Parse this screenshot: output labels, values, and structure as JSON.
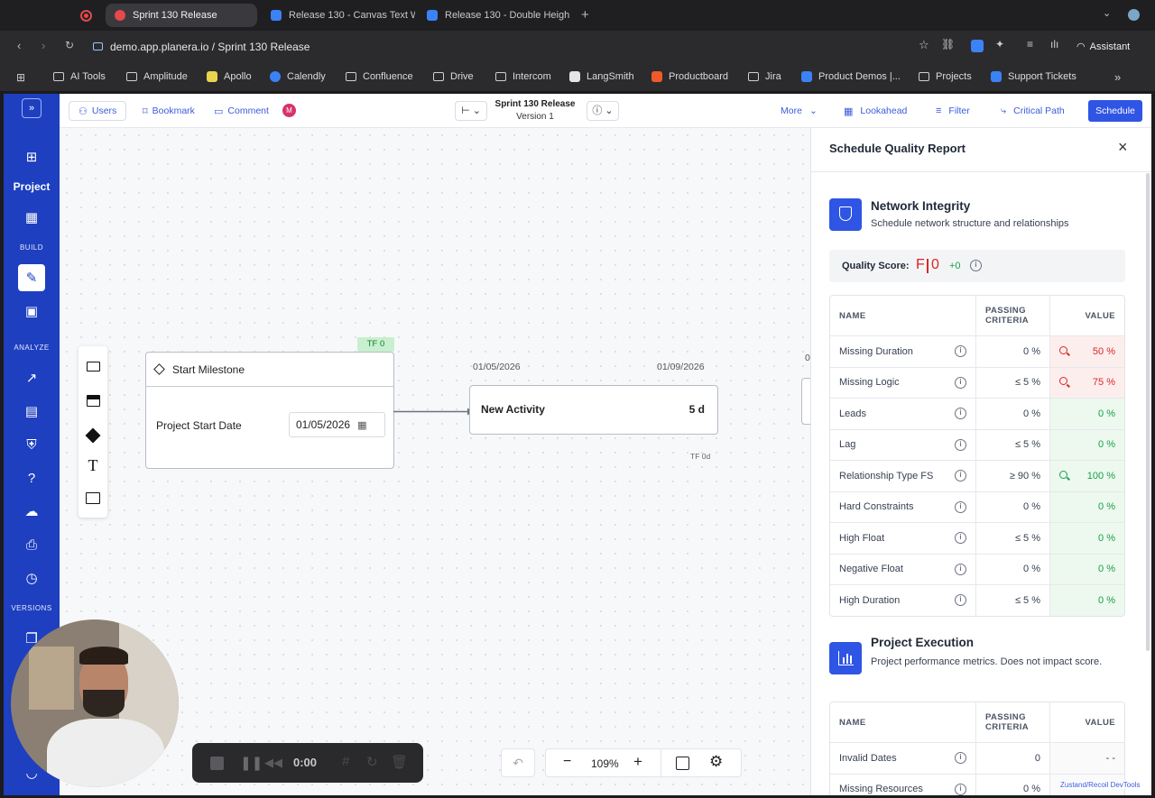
{
  "browser": {
    "tabs": [
      {
        "title": "Sprint 130 Release",
        "active": true
      },
      {
        "title": "Release 130 - Canvas Text W",
        "active": false
      },
      {
        "title": "Release 130 - Double Heigh",
        "active": false
      }
    ],
    "url": "demo.app.planera.io / Sprint 130 Release",
    "assistant_label": "Assistant",
    "bookmarks": [
      "AI Tools",
      "Amplitude",
      "Apollo",
      "Calendly",
      "Confluence",
      "Drive",
      "Intercom",
      "LangSmith",
      "Productboard",
      "Jira",
      "Product Demos |...",
      "Projects",
      "Support Tickets"
    ]
  },
  "sidenav": {
    "project_label": "Project",
    "section_build": "BUILD",
    "section_analyze": "ANALYZE",
    "section_versions": "VERSIONS"
  },
  "toolbar": {
    "users": "Users",
    "bookmark": "Bookmark",
    "comment": "Comment",
    "avatar": "M",
    "title": "Sprint 130 Release",
    "version": "Version 1",
    "more": "More",
    "lookahead": "Lookahead",
    "filter": "Filter",
    "critical_path": "Critical Path",
    "schedule": "Schedule"
  },
  "canvas": {
    "milestone": {
      "tf_badge": "TF 0",
      "title": "Start Milestone",
      "field_label": "Project Start Date",
      "date": "01/05/2026"
    },
    "activity": {
      "start_date": "01/05/2026",
      "end_date": "01/09/2026",
      "title": "New Activity",
      "duration": "5 d",
      "tf": "TF 0d"
    },
    "partial_label": "0",
    "zoom": "109%",
    "recorder_time": "0:00"
  },
  "panel": {
    "title": "Schedule Quality Report",
    "network": {
      "title": "Network Integrity",
      "subtitle": "Schedule network structure and relationships",
      "quality_label": "Quality Score:",
      "grade": "F",
      "score": "0",
      "delta": "+0",
      "columns": {
        "name": "NAME",
        "criteria_1": "PASSING",
        "criteria_2": "CRITERIA",
        "value": "VALUE"
      },
      "rows": [
        {
          "name": "Missing Duration",
          "criteria": "0 %",
          "value": "50 %",
          "status": "bad",
          "magnifier": true
        },
        {
          "name": "Missing Logic",
          "criteria": "≤ 5 %",
          "value": "75 %",
          "status": "bad",
          "magnifier": true
        },
        {
          "name": "Leads",
          "criteria": "0 %",
          "value": "0 %",
          "status": "good",
          "magnifier": false
        },
        {
          "name": "Lag",
          "criteria": "≤ 5 %",
          "value": "0 %",
          "status": "good",
          "magnifier": false
        },
        {
          "name": "Relationship Type FS",
          "criteria": "≥ 90 %",
          "value": "100 %",
          "status": "good",
          "magnifier": true
        },
        {
          "name": "Hard Constraints",
          "criteria": "0 %",
          "value": "0 %",
          "status": "good",
          "magnifier": false
        },
        {
          "name": "High Float",
          "criteria": "≤ 5 %",
          "value": "0 %",
          "status": "good",
          "magnifier": false
        },
        {
          "name": "Negative Float",
          "criteria": "0 %",
          "value": "0 %",
          "status": "good",
          "magnifier": false
        },
        {
          "name": "High Duration",
          "criteria": "≤ 5 %",
          "value": "0 %",
          "status": "good",
          "magnifier": false
        }
      ]
    },
    "execution": {
      "title": "Project Execution",
      "subtitle": "Project performance metrics. Does not impact score.",
      "rows": [
        {
          "name": "Invalid Dates",
          "criteria": "0",
          "value": "- -",
          "status": "neutral",
          "magnifier": false
        },
        {
          "name": "Missing Resources",
          "criteria": "0 %",
          "value": "",
          "status": "neutral",
          "magnifier": false
        }
      ]
    },
    "devtools": "Zustand/Recoil DevTools"
  },
  "colors": {
    "brand": "#1e3fbf",
    "accent": "#3b5bdb",
    "good": "#16a34a",
    "bad": "#dc2626"
  }
}
